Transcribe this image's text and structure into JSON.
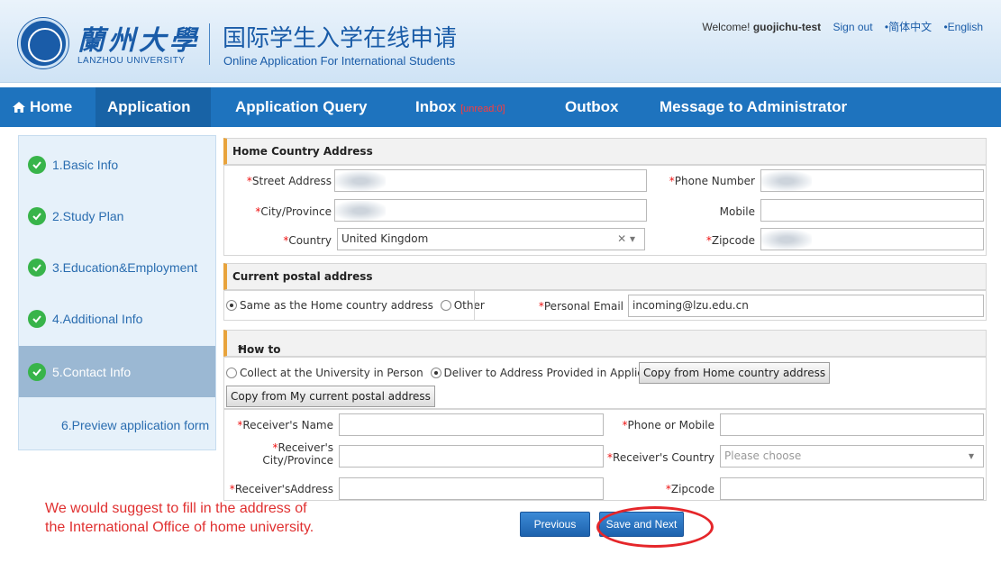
{
  "header": {
    "logo_cn": "蘭州大學",
    "logo_en": "LANZHOU UNIVERSITY",
    "title_cn": "国际学生入学在线申请",
    "title_en": "Online Application For International Students",
    "welcome": "Welcome!",
    "username": "guojichu-test",
    "sign_out": "Sign out",
    "lang_cn": "•简体中文",
    "lang_en": "•English"
  },
  "nav": {
    "home": "Home",
    "application": "Application",
    "query": "Application Query",
    "inbox": "Inbox",
    "unread": "[unread:0]",
    "outbox": "Outbox",
    "message": "Message to Administrator"
  },
  "sidebar": {
    "steps": [
      {
        "label": "1.Basic Info"
      },
      {
        "label": "2.Study Plan"
      },
      {
        "label": "3.Education&Employment"
      },
      {
        "label": "4.Additional Info"
      },
      {
        "label": "5.Contact Info"
      },
      {
        "label": "6.Preview application form"
      }
    ]
  },
  "home_address": {
    "title": "Home Country Address",
    "street_label": "Street Address",
    "phone_label": "Phone Number",
    "city_label": "City/Province",
    "mobile_label": "Mobile",
    "country_label": "Country",
    "country_value": "United Kingdom",
    "zipcode_label": "Zipcode"
  },
  "postal": {
    "title": "Current postal address",
    "same_option": "Same as the Home country address",
    "other_option": "Other",
    "email_label": "Personal Email",
    "email_value": "incoming@lzu.edu.cn"
  },
  "collect": {
    "title": "How to Collect the Admission Notice",
    "option_person": "Collect at the University in Person",
    "option_deliver": "Deliver to Address Provided in Application",
    "copy_home": "Copy from Home country address",
    "copy_current": "Copy from My current postal address",
    "receiver_name": "Receiver's Name",
    "phone_mobile": "Phone or Mobile",
    "receiver_city_1": "Receiver's",
    "receiver_city_2": "City/Province",
    "receiver_country": "Receiver's Country",
    "country_placeholder": "Please choose",
    "receiver_address": "Receiver'sAddress",
    "zipcode": "Zipcode"
  },
  "note": {
    "line1": "We would suggest to fill in the address of",
    "line2": "the International Office of home university."
  },
  "buttons": {
    "previous": "Previous",
    "save_next": "Save and Next"
  },
  "colors": {
    "nav_bg": "#1e73be",
    "active_step": "#9bb8d3",
    "check": "#38b44a",
    "annotation": "#e03030"
  }
}
